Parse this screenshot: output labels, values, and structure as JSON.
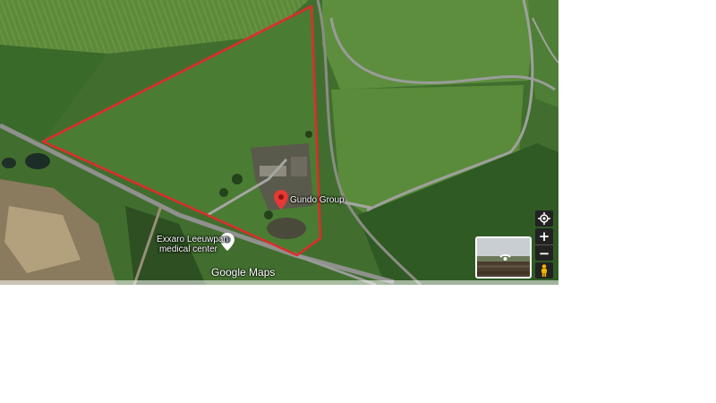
{
  "map": {
    "place_label": "Gundo Group",
    "poi_label_line1": "Exxaro Leeuwpan",
    "poi_label_line2": "medical center",
    "watermark": "Google Maps",
    "pin_color": "#e53935",
    "boundary_color": "#e02b2b"
  },
  "controls": {
    "zoom_in": "+",
    "zoom_out": "−",
    "locate_icon": "crosshair-icon",
    "pegman_icon": "pegman-icon",
    "street_view_icon": "street-view-thumbnail"
  }
}
